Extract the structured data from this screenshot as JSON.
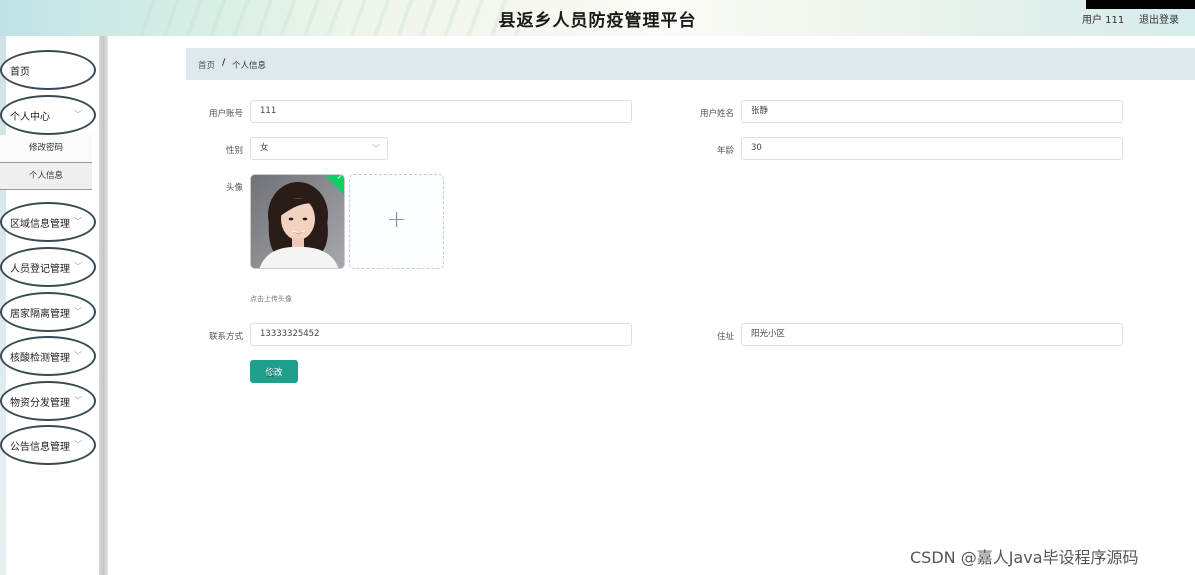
{
  "header": {
    "title": "县返乡人员防疫管理平台",
    "user_label": "用户 111",
    "logout_label": "退出登录"
  },
  "sidebar": {
    "items": [
      {
        "label": "首页"
      },
      {
        "label": "个人中心",
        "expanded": true,
        "children": [
          {
            "label": "修改密码"
          },
          {
            "label": "个人信息",
            "active": true
          }
        ]
      },
      {
        "label": "区域信息管理"
      },
      {
        "label": "人员登记管理"
      },
      {
        "label": "居家隔离管理"
      },
      {
        "label": "核酸检测管理"
      },
      {
        "label": "物资分发管理"
      },
      {
        "label": "公告信息管理"
      }
    ]
  },
  "breadcrumb": {
    "home": "首页",
    "separator": "/",
    "current": "个人信息"
  },
  "form": {
    "account_label": "用户账号",
    "account_value": "111",
    "name_label": "用户姓名",
    "name_value": "张静",
    "gender_label": "性别",
    "gender_value": "女",
    "age_label": "年龄",
    "age_value": "30",
    "avatar_label": "头像",
    "upload_tip": "点击上传头像",
    "phone_label": "联系方式",
    "phone_value": "13333325452",
    "address_label": "住址",
    "address_value": "阳光小区",
    "submit_label": "修改"
  },
  "watermark": "CSDN @嘉人Java毕设程序源码",
  "colors": {
    "primary": "#1f9f8c",
    "breadcrumb_bg": "#dde9ec",
    "success_badge": "#13ce66"
  }
}
